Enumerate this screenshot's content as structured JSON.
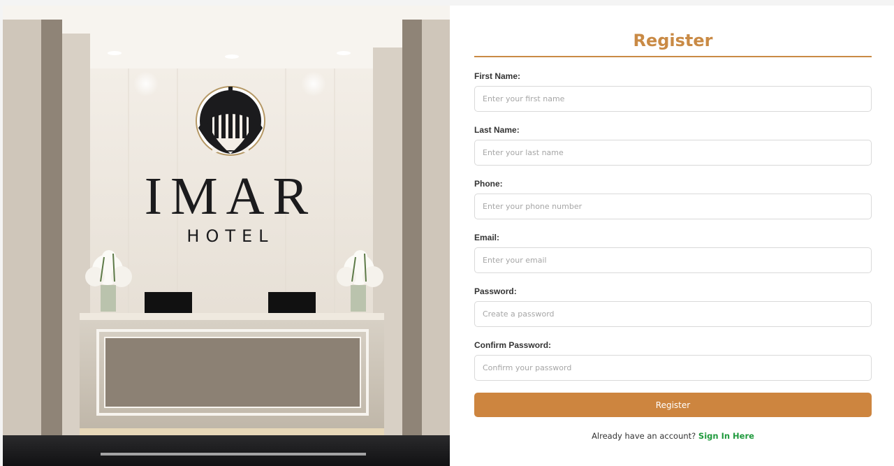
{
  "hero": {
    "brand_name": "IMAR",
    "brand_sub": "HOTEL"
  },
  "form": {
    "title": "Register",
    "fields": [
      {
        "label": "First Name:",
        "placeholder": "Enter your first name",
        "value": ""
      },
      {
        "label": "Last Name:",
        "placeholder": "Enter your last name",
        "value": ""
      },
      {
        "label": "Phone:",
        "placeholder": "Enter your phone number",
        "value": ""
      },
      {
        "label": "Email:",
        "placeholder": "Enter your email",
        "value": ""
      },
      {
        "label": "Password:",
        "placeholder": "Create a password",
        "value": ""
      },
      {
        "label": "Confirm Password:",
        "placeholder": "Confirm your password",
        "value": ""
      }
    ],
    "submit_label": "Register",
    "signin_prompt": "Already have an account?",
    "signin_link": "Sign In Here"
  },
  "colors": {
    "accent": "#cd853f",
    "link": "#1f9a3d",
    "panel_bg": "#ffffff",
    "page_bg": "#f4f4f4"
  }
}
